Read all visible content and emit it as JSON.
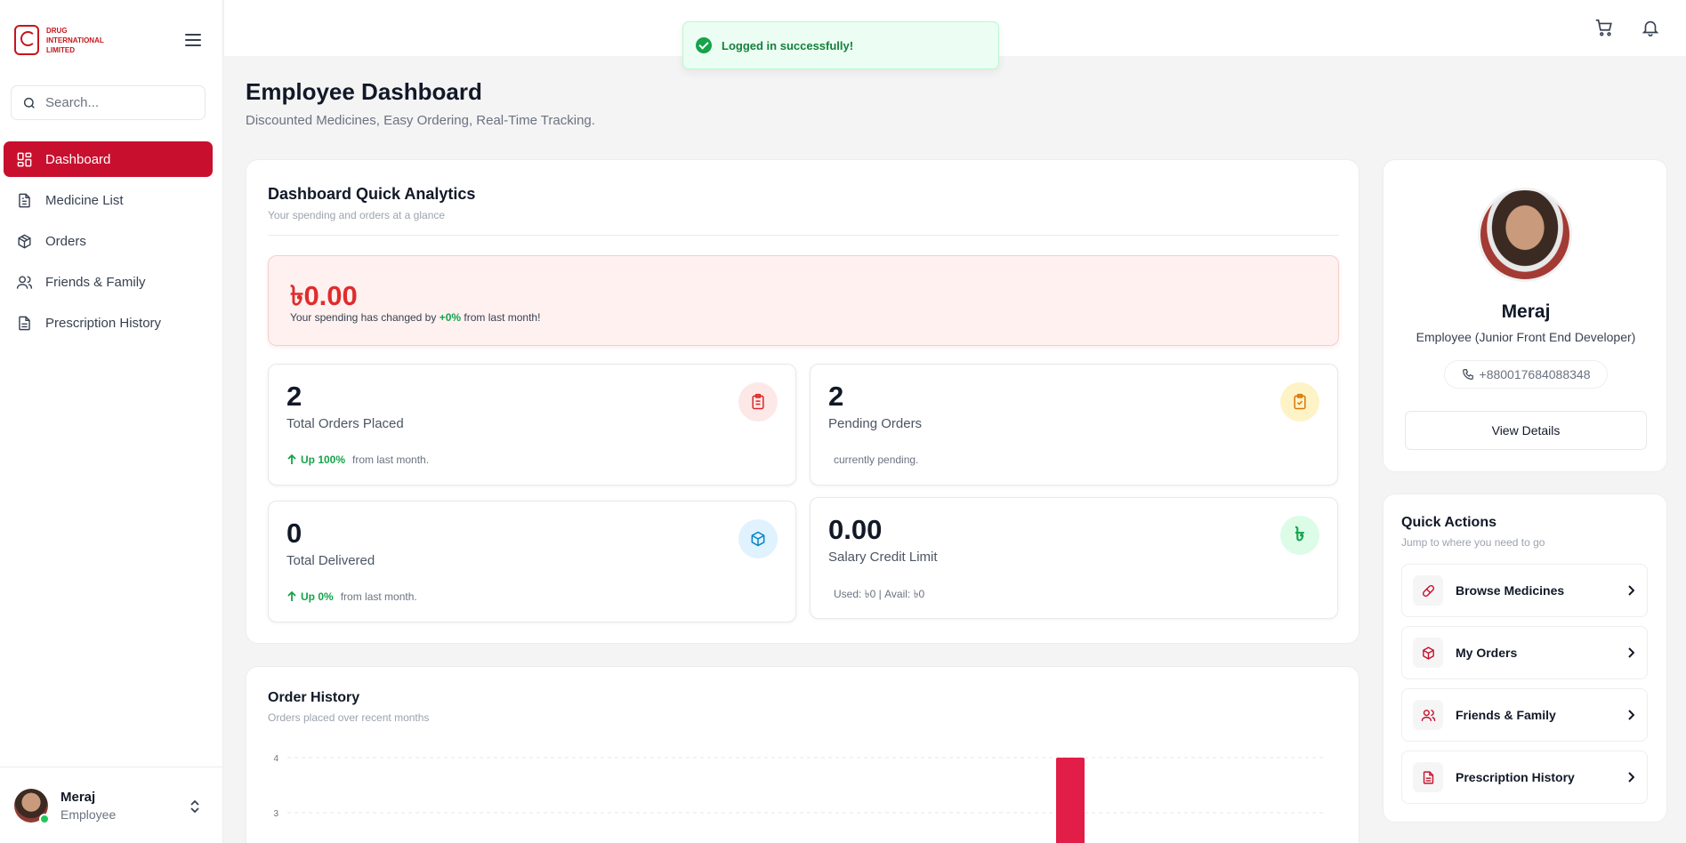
{
  "brand": {
    "logo_text": "DRUG INTERNATIONAL LIMITED",
    "accent": "#c8102e"
  },
  "sidebar": {
    "search_placeholder": "Search...",
    "items": [
      {
        "label": "Dashboard",
        "icon": "grid-icon",
        "active": true
      },
      {
        "label": "Medicine List",
        "icon": "document-icon"
      },
      {
        "label": "Orders",
        "icon": "package-icon"
      },
      {
        "label": "Friends & Family",
        "icon": "users-icon"
      },
      {
        "label": "Prescription History",
        "icon": "file-icon"
      }
    ],
    "user": {
      "name": "Meraj",
      "role": "Employee"
    }
  },
  "toast": {
    "message": "Logged in successfully!"
  },
  "header": {
    "title": "Employee Dashboard",
    "subtitle": "Discounted Medicines, Easy Ordering, Real-Time Tracking."
  },
  "analytics": {
    "title": "Dashboard Quick Analytics",
    "subtitle": "Your spending and orders at a glance",
    "spending": {
      "amount": "৳0.00",
      "desc_prefix": "Your spending has changed by ",
      "change": "+0%",
      "desc_suffix": " from last month!"
    },
    "stats": [
      {
        "value": "2",
        "label": "Total Orders Placed",
        "trend": "Up 100%",
        "note": "from last month.",
        "icon": "clipboard-icon"
      },
      {
        "value": "2",
        "label": "Pending Orders",
        "trend": "",
        "note": "currently pending.",
        "icon": "clipboard-check-icon"
      },
      {
        "value": "0",
        "label": "Total Delivered",
        "trend": "Up 0%",
        "note": "from last month.",
        "icon": "box-icon"
      },
      {
        "value": "0.00",
        "label": "Salary Credit Limit",
        "trend": "",
        "note": "Used: ৳0 | Avail: ৳0",
        "icon": "taka-icon"
      }
    ]
  },
  "order_history": {
    "title": "Order History",
    "subtitle": "Orders placed over recent months"
  },
  "chart_data": {
    "type": "bar",
    "title": "Order History",
    "y_ticks": [
      4,
      3
    ],
    "bars": [
      {
        "value": 4
      }
    ],
    "color": "#e11d48"
  },
  "profile": {
    "name": "Meraj",
    "role": "Employee (Junior Front End Developer)",
    "phone": "+880017684088348",
    "view_details": "View Details"
  },
  "quick_actions": {
    "title": "Quick Actions",
    "subtitle": "Jump to where you need to go",
    "items": [
      {
        "label": "Browse Medicines",
        "icon": "pill-icon"
      },
      {
        "label": "My Orders",
        "icon": "package-icon"
      },
      {
        "label": "Friends & Family",
        "icon": "users-icon"
      },
      {
        "label": "Prescription History",
        "icon": "file-icon"
      }
    ]
  }
}
